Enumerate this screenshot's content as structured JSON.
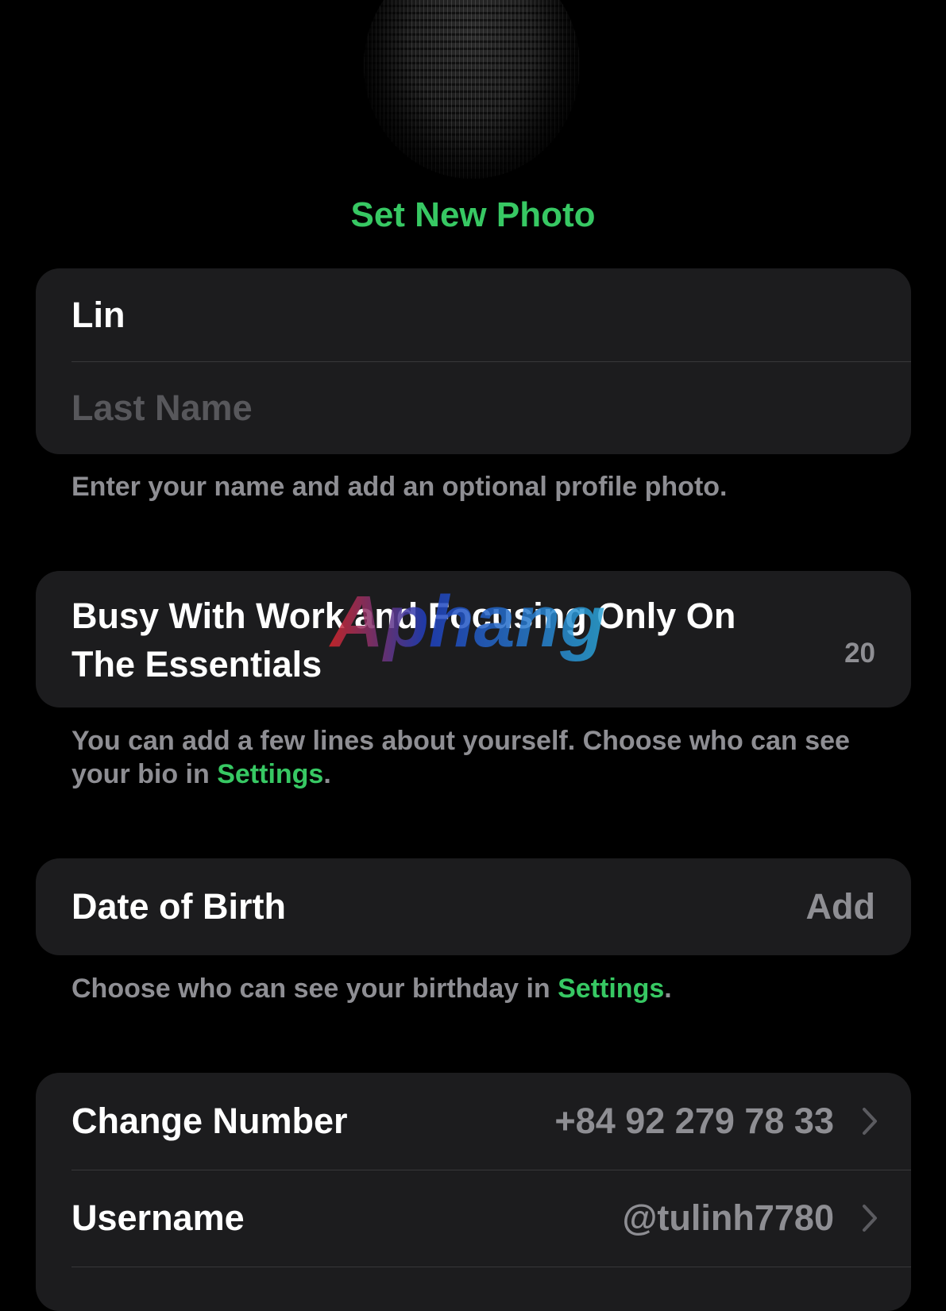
{
  "profile": {
    "set_photo_label": "Set New Photo"
  },
  "name_section": {
    "first_name": "Lin",
    "last_name_placeholder": "Last Name",
    "hint": "Enter your name and add an optional profile photo."
  },
  "bio_section": {
    "bio_text": "Busy With Work and Focusing Only On The Essentials",
    "char_count": "20",
    "hint_prefix": "You can add a few lines about yourself. Choose who can see your bio in ",
    "hint_link": "Settings",
    "hint_suffix": "."
  },
  "birthday_section": {
    "label": "Date of Birth",
    "action": "Add",
    "hint_prefix": "Choose who can see your birthday in ",
    "hint_link": "Settings",
    "hint_suffix": "."
  },
  "account_section": {
    "change_number_label": "Change Number",
    "phone_number": "+84 92 279 78 33",
    "username_label": "Username",
    "username_value": "@tulinh7780"
  },
  "watermark": {
    "text": "Aphang"
  },
  "colors": {
    "accent": "#37c863",
    "card_bg": "#1c1c1e",
    "secondary_text": "#8e8e93",
    "placeholder_text": "#57575b",
    "separator": "#38383a"
  },
  "icons": {
    "chevron": "chevron-right-icon"
  }
}
